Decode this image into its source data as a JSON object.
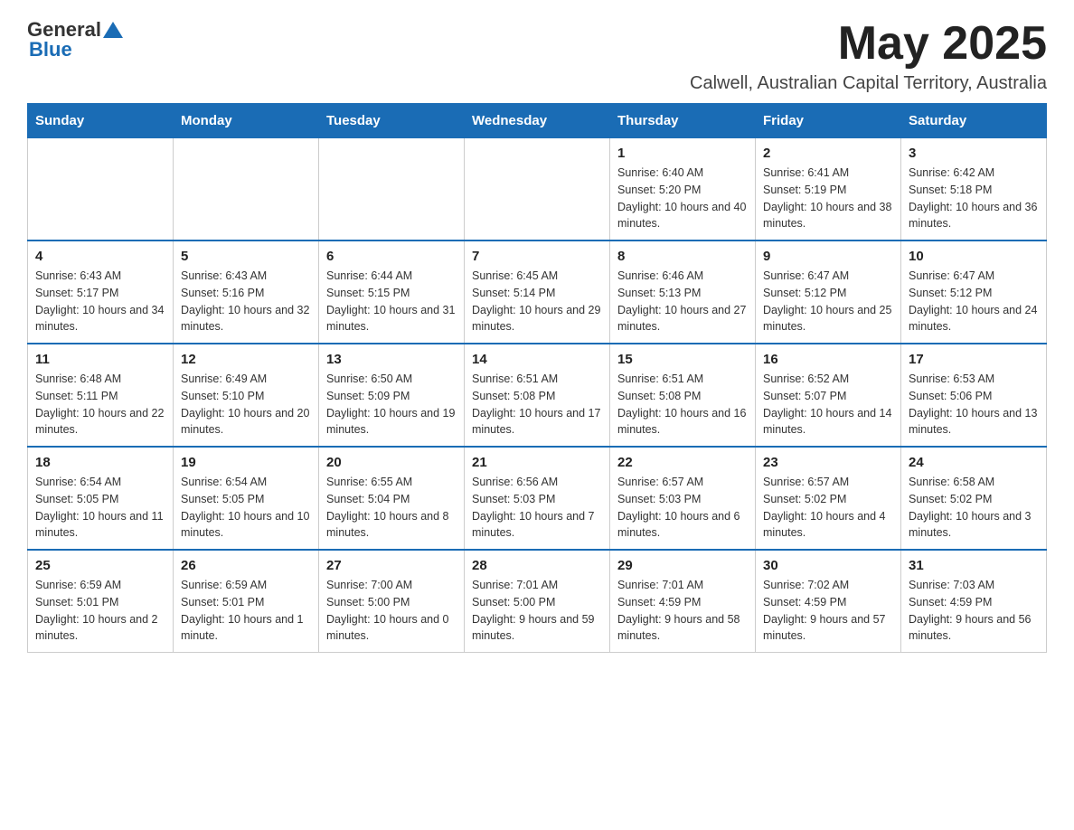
{
  "header": {
    "logo_general": "General",
    "logo_blue": "Blue",
    "month_year": "May 2025",
    "location": "Calwell, Australian Capital Territory, Australia"
  },
  "days_of_week": [
    "Sunday",
    "Monday",
    "Tuesday",
    "Wednesday",
    "Thursday",
    "Friday",
    "Saturday"
  ],
  "weeks": [
    {
      "days": [
        {
          "number": "",
          "info": ""
        },
        {
          "number": "",
          "info": ""
        },
        {
          "number": "",
          "info": ""
        },
        {
          "number": "",
          "info": ""
        },
        {
          "number": "1",
          "info": "Sunrise: 6:40 AM\nSunset: 5:20 PM\nDaylight: 10 hours and 40 minutes."
        },
        {
          "number": "2",
          "info": "Sunrise: 6:41 AM\nSunset: 5:19 PM\nDaylight: 10 hours and 38 minutes."
        },
        {
          "number": "3",
          "info": "Sunrise: 6:42 AM\nSunset: 5:18 PM\nDaylight: 10 hours and 36 minutes."
        }
      ]
    },
    {
      "days": [
        {
          "number": "4",
          "info": "Sunrise: 6:43 AM\nSunset: 5:17 PM\nDaylight: 10 hours and 34 minutes."
        },
        {
          "number": "5",
          "info": "Sunrise: 6:43 AM\nSunset: 5:16 PM\nDaylight: 10 hours and 32 minutes."
        },
        {
          "number": "6",
          "info": "Sunrise: 6:44 AM\nSunset: 5:15 PM\nDaylight: 10 hours and 31 minutes."
        },
        {
          "number": "7",
          "info": "Sunrise: 6:45 AM\nSunset: 5:14 PM\nDaylight: 10 hours and 29 minutes."
        },
        {
          "number": "8",
          "info": "Sunrise: 6:46 AM\nSunset: 5:13 PM\nDaylight: 10 hours and 27 minutes."
        },
        {
          "number": "9",
          "info": "Sunrise: 6:47 AM\nSunset: 5:12 PM\nDaylight: 10 hours and 25 minutes."
        },
        {
          "number": "10",
          "info": "Sunrise: 6:47 AM\nSunset: 5:12 PM\nDaylight: 10 hours and 24 minutes."
        }
      ]
    },
    {
      "days": [
        {
          "number": "11",
          "info": "Sunrise: 6:48 AM\nSunset: 5:11 PM\nDaylight: 10 hours and 22 minutes."
        },
        {
          "number": "12",
          "info": "Sunrise: 6:49 AM\nSunset: 5:10 PM\nDaylight: 10 hours and 20 minutes."
        },
        {
          "number": "13",
          "info": "Sunrise: 6:50 AM\nSunset: 5:09 PM\nDaylight: 10 hours and 19 minutes."
        },
        {
          "number": "14",
          "info": "Sunrise: 6:51 AM\nSunset: 5:08 PM\nDaylight: 10 hours and 17 minutes."
        },
        {
          "number": "15",
          "info": "Sunrise: 6:51 AM\nSunset: 5:08 PM\nDaylight: 10 hours and 16 minutes."
        },
        {
          "number": "16",
          "info": "Sunrise: 6:52 AM\nSunset: 5:07 PM\nDaylight: 10 hours and 14 minutes."
        },
        {
          "number": "17",
          "info": "Sunrise: 6:53 AM\nSunset: 5:06 PM\nDaylight: 10 hours and 13 minutes."
        }
      ]
    },
    {
      "days": [
        {
          "number": "18",
          "info": "Sunrise: 6:54 AM\nSunset: 5:05 PM\nDaylight: 10 hours and 11 minutes."
        },
        {
          "number": "19",
          "info": "Sunrise: 6:54 AM\nSunset: 5:05 PM\nDaylight: 10 hours and 10 minutes."
        },
        {
          "number": "20",
          "info": "Sunrise: 6:55 AM\nSunset: 5:04 PM\nDaylight: 10 hours and 8 minutes."
        },
        {
          "number": "21",
          "info": "Sunrise: 6:56 AM\nSunset: 5:03 PM\nDaylight: 10 hours and 7 minutes."
        },
        {
          "number": "22",
          "info": "Sunrise: 6:57 AM\nSunset: 5:03 PM\nDaylight: 10 hours and 6 minutes."
        },
        {
          "number": "23",
          "info": "Sunrise: 6:57 AM\nSunset: 5:02 PM\nDaylight: 10 hours and 4 minutes."
        },
        {
          "number": "24",
          "info": "Sunrise: 6:58 AM\nSunset: 5:02 PM\nDaylight: 10 hours and 3 minutes."
        }
      ]
    },
    {
      "days": [
        {
          "number": "25",
          "info": "Sunrise: 6:59 AM\nSunset: 5:01 PM\nDaylight: 10 hours and 2 minutes."
        },
        {
          "number": "26",
          "info": "Sunrise: 6:59 AM\nSunset: 5:01 PM\nDaylight: 10 hours and 1 minute."
        },
        {
          "number": "27",
          "info": "Sunrise: 7:00 AM\nSunset: 5:00 PM\nDaylight: 10 hours and 0 minutes."
        },
        {
          "number": "28",
          "info": "Sunrise: 7:01 AM\nSunset: 5:00 PM\nDaylight: 9 hours and 59 minutes."
        },
        {
          "number": "29",
          "info": "Sunrise: 7:01 AM\nSunset: 4:59 PM\nDaylight: 9 hours and 58 minutes."
        },
        {
          "number": "30",
          "info": "Sunrise: 7:02 AM\nSunset: 4:59 PM\nDaylight: 9 hours and 57 minutes."
        },
        {
          "number": "31",
          "info": "Sunrise: 7:03 AM\nSunset: 4:59 PM\nDaylight: 9 hours and 56 minutes."
        }
      ]
    }
  ]
}
